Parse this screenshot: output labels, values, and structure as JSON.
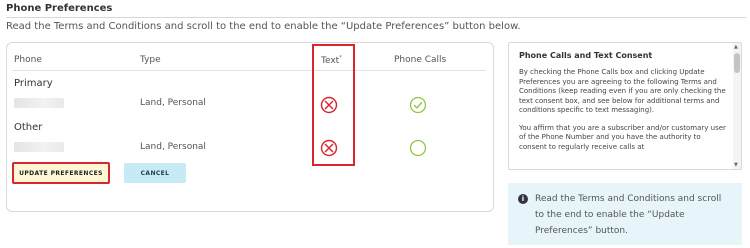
{
  "page": {
    "title": "Phone Preferences",
    "instructions": "Read the Terms and Conditions and scroll to the end to enable the “Update Preferences” button below."
  },
  "table": {
    "headers": {
      "phone": "Phone",
      "type": "Type",
      "text": "Text",
      "text_marker": "*",
      "phone_calls": "Phone Calls"
    },
    "rows": [
      {
        "section": "Primary",
        "type": "Land, Personal",
        "text_state": "not-allowed",
        "calls_state": "checked"
      },
      {
        "section": "Other",
        "type": "Land, Personal",
        "text_state": "not-allowed",
        "calls_state": "unchecked"
      }
    ]
  },
  "buttons": {
    "update": "UPDATE PREFERENCES",
    "cancel": "CANCEL"
  },
  "terms": {
    "title": "Phone Calls and Text Consent",
    "paragraph1": "By checking the Phone Calls box and clicking Update Preferences you are agreeing to the following Terms and Conditions (keep reading even if you are only checking the text consent box, and see below for additional terms and conditions specific to text messaging).",
    "paragraph2": "You affirm that you are a subscriber and/or customary user of the Phone Number and you have the authority to consent to regularly receive calls at"
  },
  "notice": {
    "icon": "info-icon",
    "text": "Read the Terms and Conditions and scroll to the end to enable the “Update Preferences” button."
  },
  "colors": {
    "highlight": "#d9262e",
    "check": "#8cc63f",
    "update_bg": "#fff6d6",
    "cancel_bg": "#c6ebf7",
    "notice_bg": "#e7f4f9"
  }
}
